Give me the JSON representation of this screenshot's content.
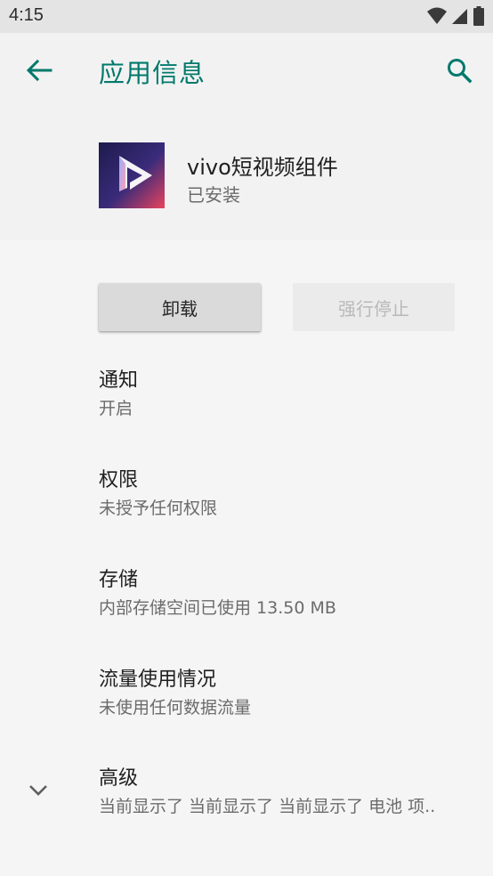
{
  "status_bar": {
    "time": "4:15",
    "icons": [
      "wifi-icon",
      "signal-icon",
      "battery-icon"
    ]
  },
  "app_bar": {
    "title": "应用信息",
    "back_icon": "arrow-left-icon",
    "search_icon": "search-icon"
  },
  "app": {
    "name": "vivo短视频组件",
    "status": "已安装"
  },
  "buttons": {
    "uninstall": "卸载",
    "force_stop": "强行停止"
  },
  "settings": [
    {
      "title": "通知",
      "summary": "开启"
    },
    {
      "title": "权限",
      "summary": "未授予任何权限"
    },
    {
      "title": "存储",
      "summary": "内部存储空间已使用 13.50 MB"
    },
    {
      "title": "流量使用情况",
      "summary": "未使用任何数据流量"
    },
    {
      "title": "高级",
      "summary": "当前显示了 当前显示了 当前显示了 电池 项.."
    }
  ],
  "colors": {
    "accent": "#00796b",
    "background": "#f5f5f5",
    "status_bar": "#e4e4e4"
  }
}
